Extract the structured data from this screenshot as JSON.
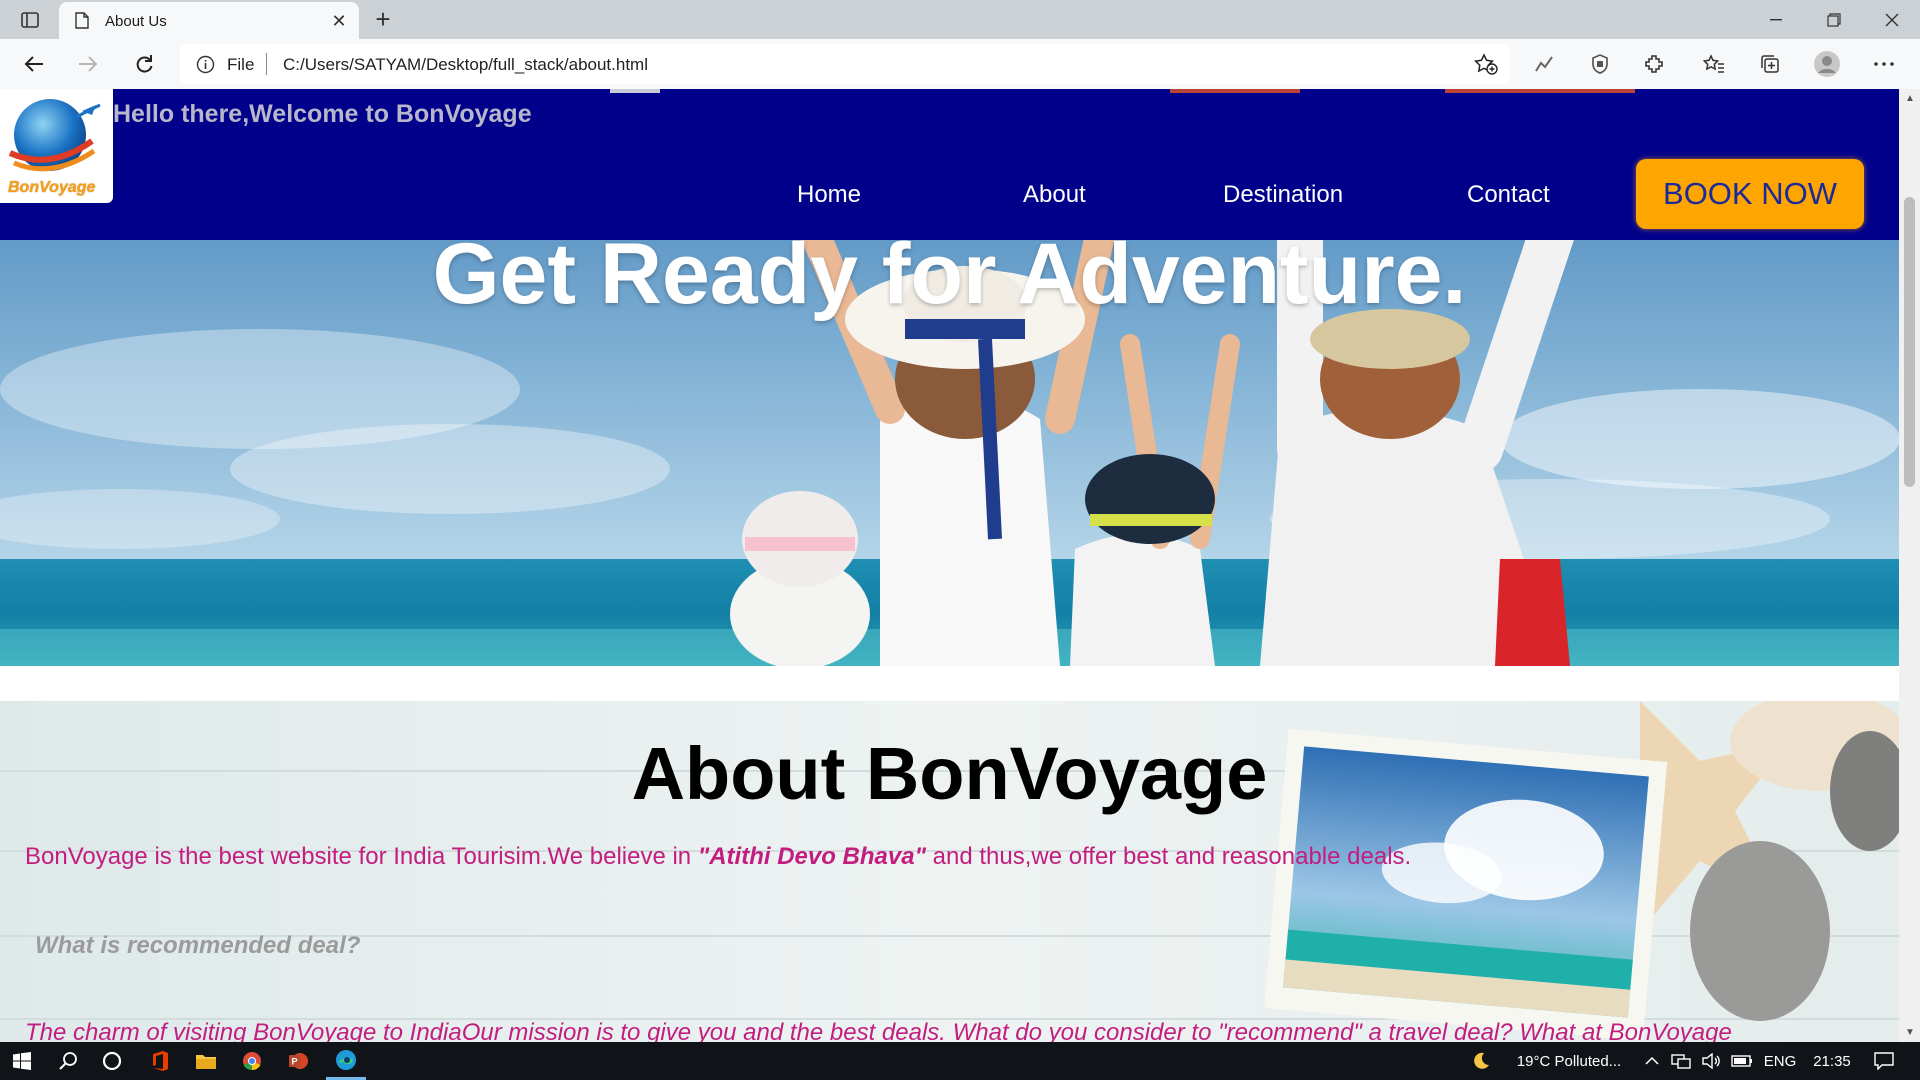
{
  "browser": {
    "tab_title": "About Us",
    "tab_close": "✕",
    "new_tab": "+",
    "omnibox_scheme": "File",
    "url": "C:/Users/SATYAM/Desktop/full_stack/about.html"
  },
  "header": {
    "logo_text": "BonVoyage",
    "welcome": "Hello there,Welcome to BonVoyage",
    "nav": [
      {
        "label": "Home"
      },
      {
        "label": "About"
      },
      {
        "label": "Destination"
      },
      {
        "label": "Contact"
      }
    ],
    "cta": "BOOK NOW"
  },
  "hero": {
    "title": "Get Ready for Adventure."
  },
  "about": {
    "title": "About BonVoyage",
    "para_start": "BonVoyage is the best website for India Tourisim.We believe in ",
    "para_em": "\"Atithi Devo Bhava\"",
    "para_end": " and thus,we offer best and reasonable deals.",
    "question": "What is recommended deal?",
    "cut_text": "The charm of visiting BonVoyage to IndiaOur mission is to give you and the best deals. What do you consider to \"recommend\" a travel deal? What at BonVoyage"
  },
  "taskbar": {
    "weather": "19°C  Polluted...",
    "language": "ENG",
    "time": "21:35"
  },
  "colors": {
    "header_bg": "#00008b",
    "cta_bg": "#ffa500",
    "accent_text": "#c21d7f"
  }
}
